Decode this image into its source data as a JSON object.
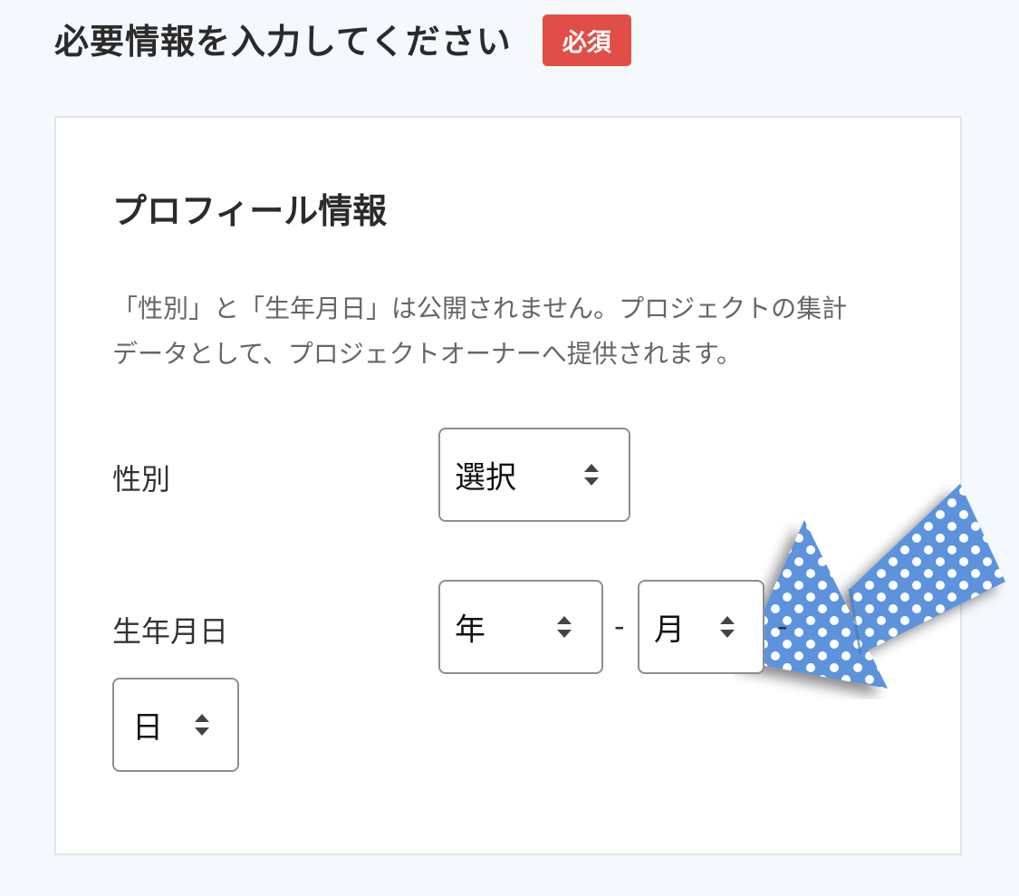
{
  "header": {
    "title": "必要情報を入力してください",
    "required_badge": "必須"
  },
  "profile": {
    "section_title": "プロフィール情報",
    "notice_line1": "「性別」と「生年月日」は公開されません。プロジェクトの集計",
    "notice_line2": "データとして、プロジェクトオーナーへ提供されます。",
    "gender": {
      "label": "性別",
      "selected": "選択"
    },
    "birthday": {
      "label": "生年月日",
      "year": "年",
      "month": "月",
      "day": "日",
      "separator": "-"
    }
  },
  "colors": {
    "badge": "#e04e47",
    "background": "#f5f8fc",
    "decor_arrow": "#5b93dc"
  },
  "icons": {
    "select_arrows": "updown-arrows-icon",
    "decoration": "polka-dot-arrow-icon"
  }
}
